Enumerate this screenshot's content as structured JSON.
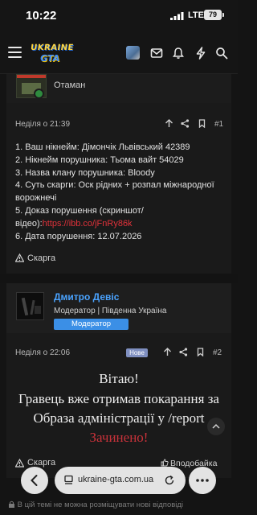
{
  "status_bar": {
    "time": "10:22",
    "network": "LTE",
    "battery": "79"
  },
  "header": {
    "logo_line1": "UKRAINE",
    "logo_line2": "GTA"
  },
  "post1": {
    "role": "Отаман",
    "date": "Неділя о 21:39",
    "number": "#1",
    "lines": [
      "1. Ваш нікнейм: Дімончік Львівський 42389",
      "2. Нікнейм порушника: Тьома вайт 54029",
      "3. Назва клану порушника: Bloody",
      "4. Суть скарги: Оск рідних + розпал міжнародної ворожнечі",
      "5. Доказ порушення (скриншот/відео):"
    ],
    "proof_link": "https://ibb.co/jFnRy86k",
    "line6": "6. Дата порушення: 12.07.2026",
    "report_label": "Скарга"
  },
  "post2": {
    "author": "Дмитро Девіс",
    "role": "Модератор | Південна Україна",
    "badge": "Модератор",
    "date": "Неділя о 22:06",
    "new_badge": "Нове",
    "number": "#2",
    "message_lines": [
      "Вітаю!",
      "Гравець вже отримав покарання за",
      "Образа адміністрації у /report"
    ],
    "status_text": "Зачинено!",
    "report_label": "Скарга",
    "like_label": "Вподобайка"
  },
  "browser": {
    "url": "ukraine-gta.com.ua"
  },
  "footer_note": "В цій темі не можна розміщувати нові відповіді"
}
